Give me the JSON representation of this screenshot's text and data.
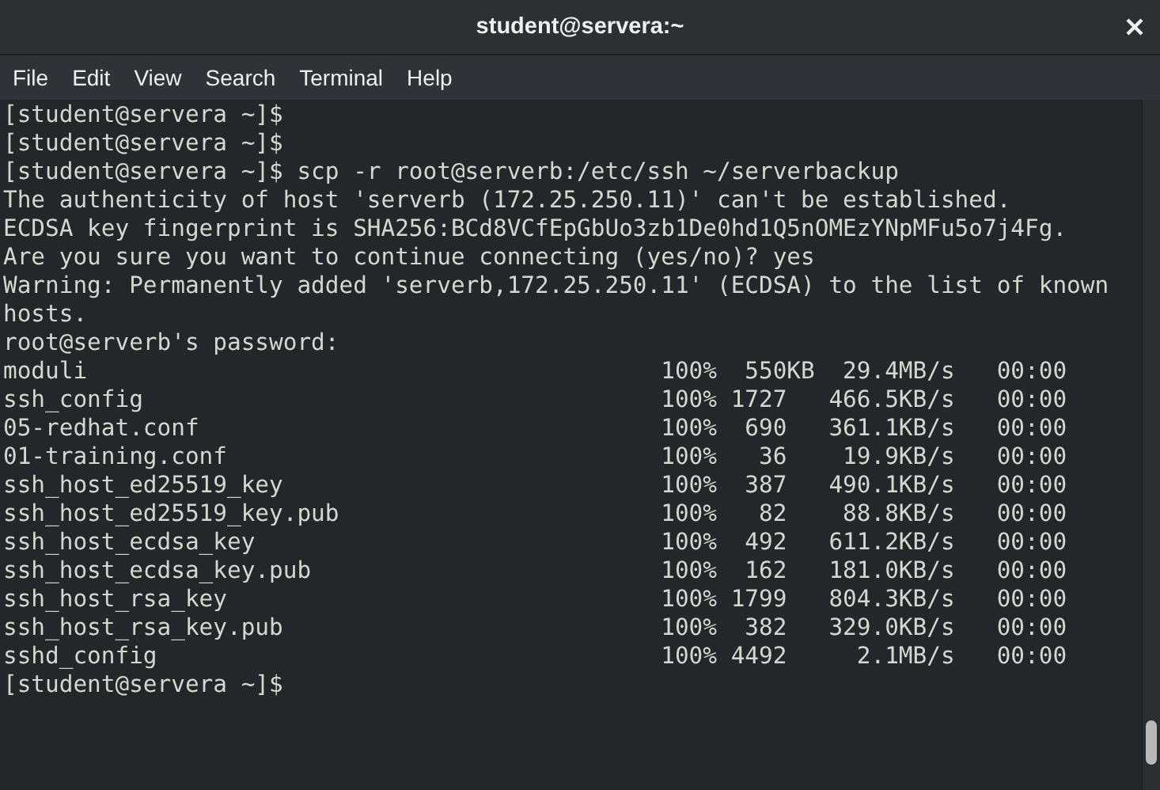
{
  "window": {
    "title": "student@servera:~"
  },
  "menu": [
    "File",
    "Edit",
    "View",
    "Search",
    "Terminal",
    "Help"
  ],
  "terminal": {
    "lines": [
      "[student@servera ~]$",
      "[student@servera ~]$",
      "[student@servera ~]$ scp -r root@serverb:/etc/ssh ~/serverbackup",
      "The authenticity of host 'serverb (172.25.250.11)' can't be established.",
      "ECDSA key fingerprint is SHA256:BCd8VCfEpGbUo3zb1De0hd1Q5nOMEzYNpMFu5o7j4Fg.",
      "Are you sure you want to continue connecting (yes/no)? yes",
      "Warning: Permanently added 'serverb,172.25.250.11' (ECDSA) to the list of known",
      "hosts.",
      "root@serverb's password:",
      "moduli                                         100%  550KB  29.4MB/s   00:00",
      "ssh_config                                     100% 1727   466.5KB/s   00:00",
      "05-redhat.conf                                 100%  690   361.1KB/s   00:00",
      "01-training.conf                               100%   36    19.9KB/s   00:00",
      "ssh_host_ed25519_key                           100%  387   490.1KB/s   00:00",
      "ssh_host_ed25519_key.pub                       100%   82    88.8KB/s   00:00",
      "ssh_host_ecdsa_key                             100%  492   611.2KB/s   00:00",
      "ssh_host_ecdsa_key.pub                         100%  162   181.0KB/s   00:00",
      "ssh_host_rsa_key                               100% 1799   804.3KB/s   00:00",
      "ssh_host_rsa_key.pub                           100%  382   329.0KB/s   00:00",
      "sshd_config                                    100% 4492     2.1MB/s   00:00",
      "[student@servera ~]$"
    ]
  }
}
